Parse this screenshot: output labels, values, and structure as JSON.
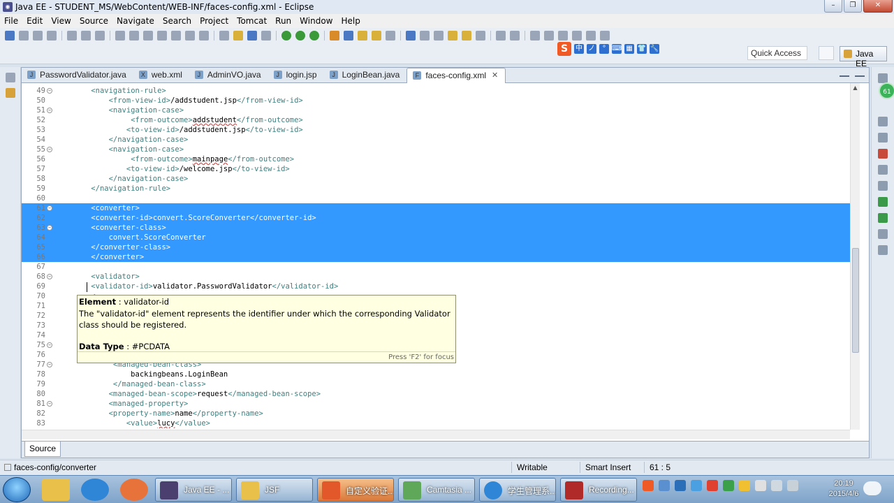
{
  "window": {
    "title": "Java EE - STUDENT_MS/WebContent/WEB-INF/faces-config.xml - Eclipse"
  },
  "menu": [
    "File",
    "Edit",
    "View",
    "Source",
    "Navigate",
    "Search",
    "Project",
    "Tomcat",
    "Run",
    "Window",
    "Help"
  ],
  "toolbar": {
    "quick_access": "Quick Access",
    "perspective": "Java EE",
    "sogou_chars": [
      "中",
      "ノ",
      "°",
      "⌨",
      "▦",
      "👕",
      "🔧"
    ]
  },
  "tabs": [
    {
      "label": "PasswordValidator.java",
      "icon": "J"
    },
    {
      "label": "web.xml",
      "icon": "X"
    },
    {
      "label": "AdminVO.java",
      "icon": "J"
    },
    {
      "label": "login.jsp",
      "icon": "J"
    },
    {
      "label": "LoginBean.java",
      "icon": "J"
    },
    {
      "label": "faces-config.xml",
      "icon": "F",
      "active": true
    }
  ],
  "code": [
    {
      "n": "49",
      "fold": true,
      "sel": false,
      "text": "    <navigation-rule>"
    },
    {
      "n": "50",
      "fold": false,
      "sel": false,
      "text": "        <from-view-id>/addstudent.jsp</from-view-id>"
    },
    {
      "n": "51",
      "fold": true,
      "sel": false,
      "text": "        <navigation-case>"
    },
    {
      "n": "52",
      "fold": false,
      "sel": false,
      "text": "             <from-outcome>addstudent</from-outcome>"
    },
    {
      "n": "53",
      "fold": false,
      "sel": false,
      "text": "            <to-view-id>/addstudent.jsp</to-view-id>"
    },
    {
      "n": "54",
      "fold": false,
      "sel": false,
      "text": "        </navigation-case>"
    },
    {
      "n": "55",
      "fold": true,
      "sel": false,
      "text": "        <navigation-case>"
    },
    {
      "n": "56",
      "fold": false,
      "sel": false,
      "text": "             <from-outcome>mainpage</from-outcome>"
    },
    {
      "n": "57",
      "fold": false,
      "sel": false,
      "text": "            <to-view-id>/welcome.jsp</to-view-id>"
    },
    {
      "n": "58",
      "fold": false,
      "sel": false,
      "text": "        </navigation-case>"
    },
    {
      "n": "59",
      "fold": false,
      "sel": false,
      "text": "    </navigation-rule>"
    },
    {
      "n": "60",
      "fold": false,
      "sel": false,
      "text": ""
    },
    {
      "n": "61",
      "fold": true,
      "sel": true,
      "text": "    <converter>"
    },
    {
      "n": "62",
      "fold": false,
      "sel": true,
      "text": "    <converter-id>convert.ScoreConverter</converter-id>"
    },
    {
      "n": "63",
      "fold": true,
      "sel": true,
      "text": "    <converter-class>"
    },
    {
      "n": "64",
      "fold": false,
      "sel": true,
      "text": "        convert.ScoreConverter"
    },
    {
      "n": "65",
      "fold": false,
      "sel": true,
      "text": "    </converter-class>"
    },
    {
      "n": "66",
      "fold": false,
      "sel": true,
      "text": "    </converter>"
    },
    {
      "n": "67",
      "fold": false,
      "sel": false,
      "text": ""
    },
    {
      "n": "68",
      "fold": true,
      "sel": false,
      "text": "    <validator>"
    },
    {
      "n": "69",
      "fold": false,
      "sel": false,
      "text": "    <validator-id>validator.PasswordValidator</validator-id>"
    },
    {
      "n": "70",
      "fold": false,
      "sel": false,
      "text": "    <"
    },
    {
      "n": "71",
      "fold": false,
      "sel": false,
      "text": "    <"
    },
    {
      "n": "72",
      "fold": false,
      "sel": false,
      "text": ""
    },
    {
      "n": "73",
      "fold": false,
      "sel": false,
      "text": ""
    },
    {
      "n": "74",
      "fold": false,
      "sel": false,
      "text": ""
    },
    {
      "n": "75",
      "fold": true,
      "sel": false,
      "text": "    <"
    },
    {
      "n": "76",
      "fold": false,
      "sel": false,
      "text": ""
    },
    {
      "n": "77",
      "fold": true,
      "sel": false,
      "text": "         <managed-bean-class>"
    },
    {
      "n": "78",
      "fold": false,
      "sel": false,
      "text": "             backingbeans.LoginBean"
    },
    {
      "n": "79",
      "fold": false,
      "sel": false,
      "text": "         </managed-bean-class>"
    },
    {
      "n": "80",
      "fold": false,
      "sel": false,
      "text": "        <managed-bean-scope>request</managed-bean-scope>"
    },
    {
      "n": "81",
      "fold": true,
      "sel": false,
      "text": "        <managed-property>"
    },
    {
      "n": "82",
      "fold": false,
      "sel": false,
      "text": "        <property-name>name</property-name>"
    },
    {
      "n": "83",
      "fold": false,
      "sel": false,
      "text": "            <value>lucy</value>"
    }
  ],
  "hover": {
    "element_label": "Element",
    "element_value": "validator-id",
    "description": "The \"validator-id\" element represents the identifier under which the corresponding Validator class should be registered.",
    "datatype_label": "Data Type",
    "datatype_value": "#PCDATA",
    "footer": "Press 'F2' for focus"
  },
  "source_tab": "Source",
  "badge": "61",
  "status": {
    "path": "faces-config/converter",
    "writable": "Writable",
    "insert_mode": "Smart Insert",
    "position": "61 : 5"
  },
  "taskbar": {
    "tasks": [
      {
        "label": "Java EE - ...",
        "active": false
      },
      {
        "label": "JSF",
        "active": false
      },
      {
        "label": "自定义验证...",
        "active": true
      },
      {
        "label": "Camtasia ...",
        "active": false
      },
      {
        "label": "学生管理系...",
        "active": false
      },
      {
        "label": "Recording...",
        "active": false
      }
    ],
    "time": "20:19",
    "date": "2015/4/6"
  }
}
